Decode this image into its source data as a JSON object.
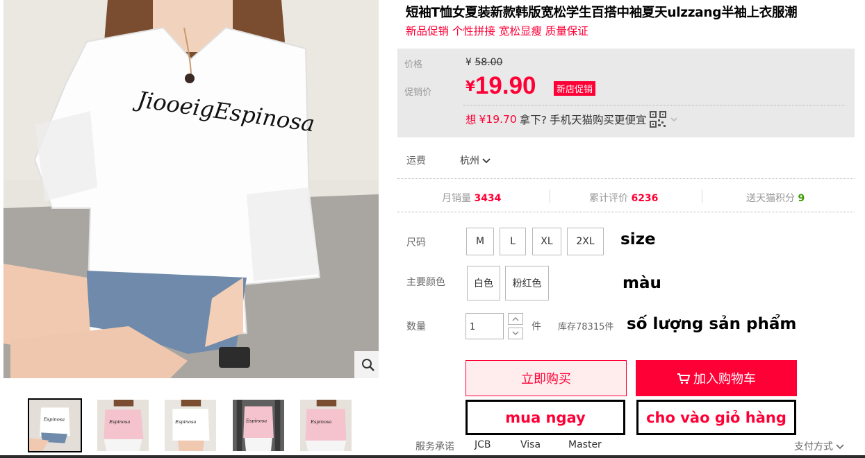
{
  "product": {
    "title": "短袖T恤女夏装新款韩版宽松学生百搭中袖夏天ulzzang半袖上衣服潮",
    "subtitle": "新品促销 个性拼接 宽松显瘦 质量保证",
    "shirt_print": "JiooeigEspinosa"
  },
  "price": {
    "label": "价格",
    "currency": "¥",
    "original": "58.00",
    "promo_label": "促销价",
    "promo": "19.90",
    "promo_tag": "新店促销",
    "mobile_prefix": "想",
    "mobile_price": "¥19.70",
    "mobile_mid": "拿下?",
    "mobile_suffix": "手机天猫购买更便宜"
  },
  "shipping": {
    "label": "运费",
    "city": "杭州"
  },
  "stats": {
    "monthly_label": "月销量",
    "monthly_value": "3434",
    "reviews_label": "累计评价",
    "reviews_value": "6236",
    "points_label": "送天猫积分",
    "points_value": "9"
  },
  "options": {
    "size_label": "尺码",
    "sizes": [
      "M",
      "L",
      "XL",
      "2XL"
    ],
    "color_label": "主要颜色",
    "colors": [
      "白色",
      "粉红色"
    ],
    "qty_label": "数量",
    "qty_value": "1",
    "qty_unit": "件",
    "stock": "库存78315件"
  },
  "annotations": {
    "size": "size",
    "color": "màu",
    "qty": "số lượng sản phẩm",
    "buy_now": "mua ngay",
    "add_cart": "cho vào giỏ hàng"
  },
  "actions": {
    "buy_now": "立即购买",
    "add_cart": "加入购物车",
    "cart_icon": "cart-icon"
  },
  "service": {
    "label": "服务承诺",
    "methods": [
      "JCB",
      "Visa",
      "Master"
    ],
    "pay_method": "支付方式"
  },
  "colors": {
    "accent": "#ff0036",
    "price_box_bg": "#e9e9e9",
    "buy_now_bg": "#ffeded",
    "green": "#3b9a00"
  }
}
